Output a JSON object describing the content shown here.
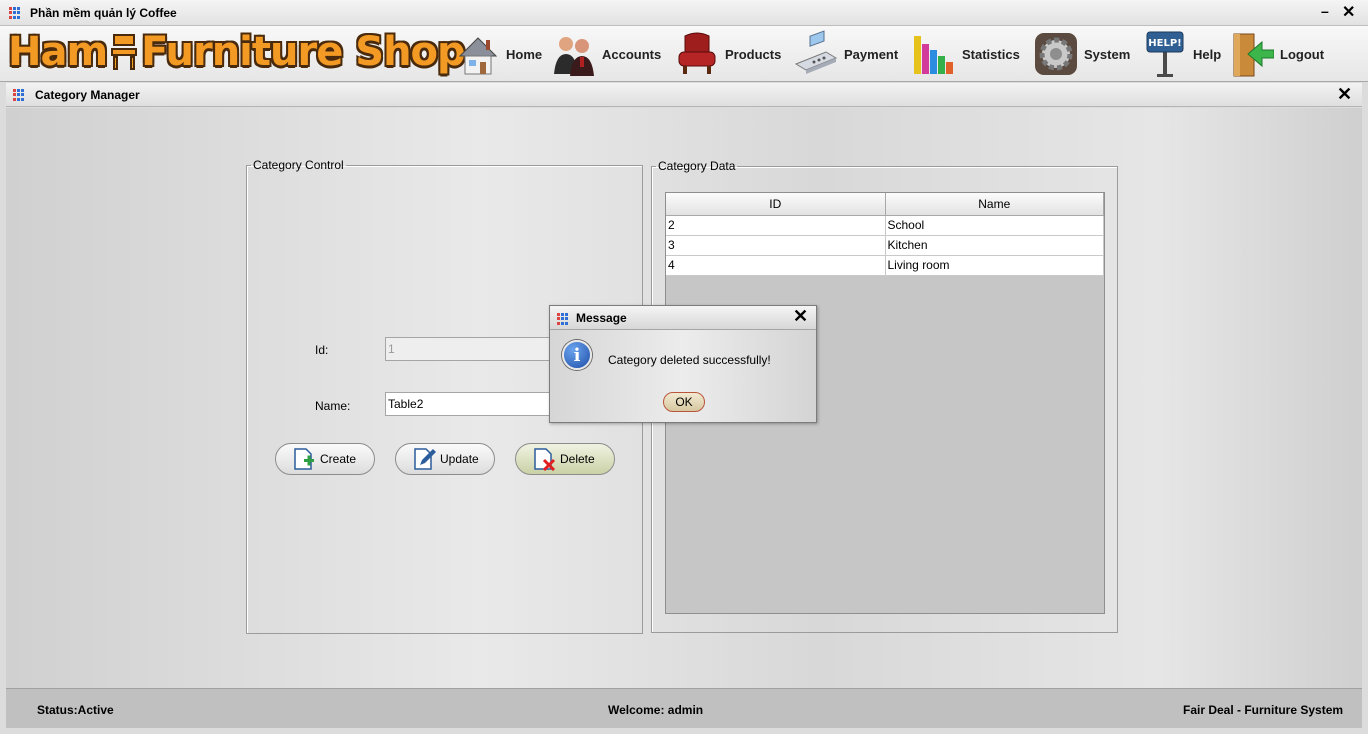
{
  "window": {
    "title": "Phần mềm quản lý Coffee",
    "minimize": "–",
    "close": "✕"
  },
  "logo": {
    "part1": "Ham",
    "part2": "Furniture Shop"
  },
  "nav": [
    {
      "label": "Home",
      "icon": "house-icon"
    },
    {
      "label": "Accounts",
      "icon": "users-icon"
    },
    {
      "label": "Products",
      "icon": "armchair-icon"
    },
    {
      "label": "Payment",
      "icon": "cash-register-icon"
    },
    {
      "label": "Statistics",
      "icon": "bar-chart-icon"
    },
    {
      "label": "System",
      "icon": "gear-icon"
    },
    {
      "label": "Help",
      "icon": "help-sign-icon"
    },
    {
      "label": "Logout",
      "icon": "logout-door-icon"
    }
  ],
  "inner_frame": {
    "title": "Category Manager",
    "close": "✕"
  },
  "category_control": {
    "legend": "Category Control",
    "id_label": "Id:",
    "id_value": "1",
    "name_label": "Name:",
    "name_value": "Table2",
    "create_label": "Create",
    "update_label": "Update",
    "delete_label": "Delete"
  },
  "category_data": {
    "legend": "Category Data",
    "columns": [
      "ID",
      "Name"
    ],
    "rows": [
      [
        "2",
        "School"
      ],
      [
        "3",
        "Kitchen"
      ],
      [
        "4",
        "Living room"
      ]
    ]
  },
  "dialog": {
    "title": "Message",
    "close": "✕",
    "message": "Category deleted successfully!",
    "ok_label": "OK",
    "icon": "info-icon"
  },
  "status": {
    "left": "Status:Active",
    "center": "Welcome: admin",
    "right": "Fair Deal - Furniture System"
  },
  "colors": {
    "logo_orange": "#f39a25",
    "logo_outline": "#4a2a0c",
    "accent_blue": "#2e6fd6"
  }
}
